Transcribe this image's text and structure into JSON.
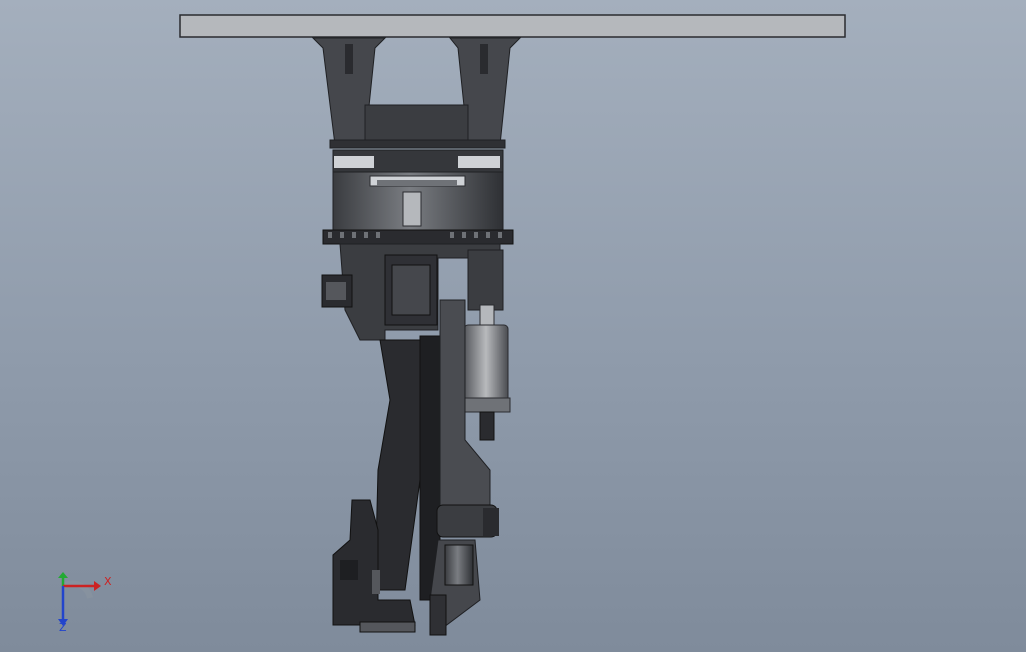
{
  "viewport": {
    "background_top": "#a4afbd",
    "background_bottom": "#7f8b9b"
  },
  "model": {
    "icon": "robot-arm-model",
    "colors": {
      "steel_dark": "#2a2b2f",
      "steel_mid": "#45474c",
      "steel_light": "#6f7277",
      "plate": "#b5b8bc",
      "highlight": "#cfd2d6"
    }
  },
  "triad": {
    "x_label": "X",
    "z_label": "Z",
    "colors": {
      "x": "#cc2222",
      "y": "#22aa33",
      "z": "#2244cc"
    }
  }
}
